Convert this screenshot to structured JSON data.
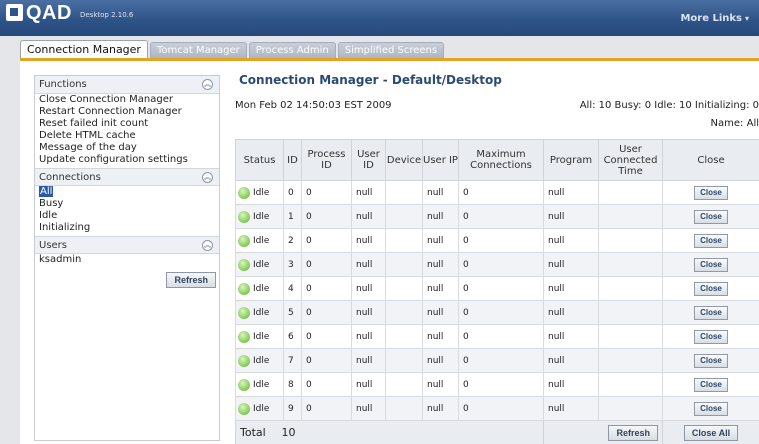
{
  "header": {
    "logo_text": "QAD",
    "version": "Desktop 2.10.6",
    "more_links": "More Links"
  },
  "tabs": [
    {
      "label": "Connection Manager",
      "active": true
    },
    {
      "label": "Tomcat Manager",
      "active": false
    },
    {
      "label": "Process Admin",
      "active": false
    },
    {
      "label": "Simplified Screens",
      "active": false
    }
  ],
  "sidebar": {
    "functions": {
      "title": "Functions",
      "items": [
        "Close Connection Manager",
        "Restart Connection Manager",
        "Reset failed init count",
        "Delete HTML cache",
        "Message of the day",
        "Update configuration settings"
      ]
    },
    "connections": {
      "title": "Connections",
      "items": [
        "All",
        "Busy",
        "Idle",
        "Initializing"
      ],
      "selected": "All"
    },
    "users": {
      "title": "Users",
      "items": [
        "ksadmin"
      ],
      "refresh_label": "Refresh"
    }
  },
  "main": {
    "title": "Connection Manager - Default/Desktop",
    "date": "Mon Feb 02 14:50:03 EST 2009",
    "summary": "All: 10 Busy: 0 Idle: 10 Initializing: 0",
    "name_label": "Name: All",
    "columns": [
      "Status",
      "ID",
      "Process ID",
      "User ID",
      "Device",
      "User IP",
      "Maximum Connections",
      "Program",
      "User Connected Time",
      "Close"
    ],
    "rows": [
      {
        "status": "Idle",
        "id": "0",
        "process_id": "0",
        "user_id": "null",
        "device": "",
        "user_ip": "null",
        "max_conn": "0",
        "program": "null",
        "time": "",
        "close": "Close"
      },
      {
        "status": "Idle",
        "id": "1",
        "process_id": "0",
        "user_id": "null",
        "device": "",
        "user_ip": "null",
        "max_conn": "0",
        "program": "null",
        "time": "",
        "close": "Close"
      },
      {
        "status": "Idle",
        "id": "2",
        "process_id": "0",
        "user_id": "null",
        "device": "",
        "user_ip": "null",
        "max_conn": "0",
        "program": "null",
        "time": "",
        "close": "Close"
      },
      {
        "status": "Idle",
        "id": "3",
        "process_id": "0",
        "user_id": "null",
        "device": "",
        "user_ip": "null",
        "max_conn": "0",
        "program": "null",
        "time": "",
        "close": "Close"
      },
      {
        "status": "Idle",
        "id": "4",
        "process_id": "0",
        "user_id": "null",
        "device": "",
        "user_ip": "null",
        "max_conn": "0",
        "program": "null",
        "time": "",
        "close": "Close"
      },
      {
        "status": "Idle",
        "id": "5",
        "process_id": "0",
        "user_id": "null",
        "device": "",
        "user_ip": "null",
        "max_conn": "0",
        "program": "null",
        "time": "",
        "close": "Close"
      },
      {
        "status": "Idle",
        "id": "6",
        "process_id": "0",
        "user_id": "null",
        "device": "",
        "user_ip": "null",
        "max_conn": "0",
        "program": "null",
        "time": "",
        "close": "Close"
      },
      {
        "status": "Idle",
        "id": "7",
        "process_id": "0",
        "user_id": "null",
        "device": "",
        "user_ip": "null",
        "max_conn": "0",
        "program": "null",
        "time": "",
        "close": "Close"
      },
      {
        "status": "Idle",
        "id": "8",
        "process_id": "0",
        "user_id": "null",
        "device": "",
        "user_ip": "null",
        "max_conn": "0",
        "program": "null",
        "time": "",
        "close": "Close"
      },
      {
        "status": "Idle",
        "id": "9",
        "process_id": "0",
        "user_id": "null",
        "device": "",
        "user_ip": "null",
        "max_conn": "0",
        "program": "null",
        "time": "",
        "close": "Close"
      }
    ],
    "footer": {
      "total_label": "Total",
      "total_value": "10",
      "refresh_label": "Refresh",
      "close_all_label": "Close All"
    }
  },
  "colors": {
    "header_bg": "#2f5488",
    "accent_tab_bar": "#e5a325",
    "title_text": "#2b4b74",
    "selected_item_bg": "#2a58a8",
    "status_idle": "#93d36a"
  },
  "icons": {
    "logo": "qad-logo-icon",
    "more_links": "chevron-down-icon",
    "collapse": "collapse-icon",
    "status": "status-dot-icon"
  }
}
